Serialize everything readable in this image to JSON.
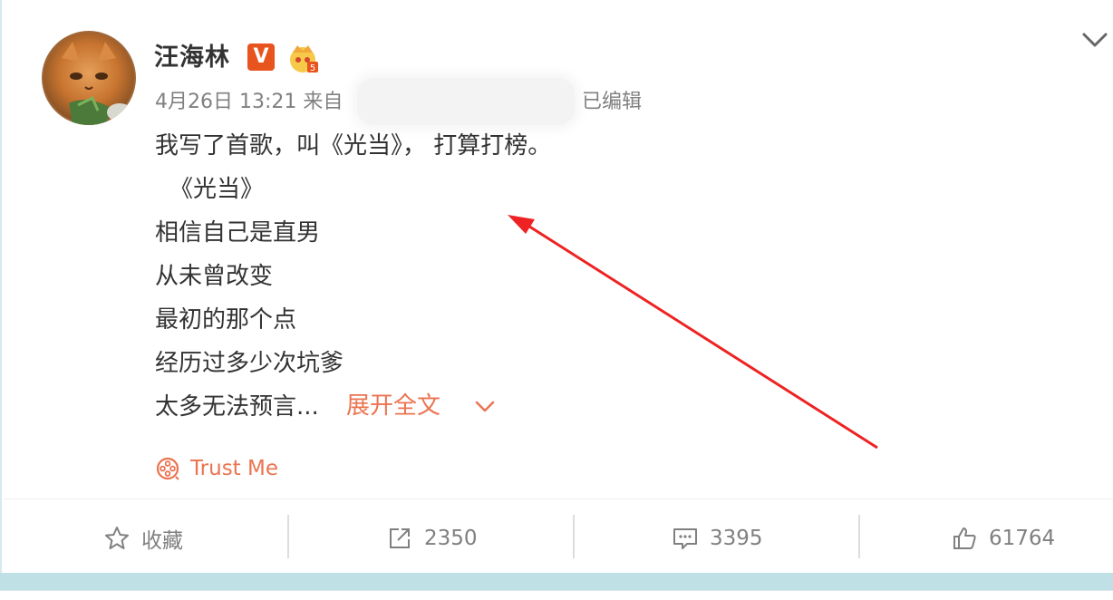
{
  "post": {
    "author": "汪海林",
    "verified_badge": "V",
    "vip_icon": "crown-icon",
    "meta_prefix": "4月26日 13:21 来自",
    "edited_label": "已编辑",
    "lines": [
      "我写了首歌，叫《光当》， 打算打榜。",
      "《光当》",
      "相信自己是直男",
      "从未曾改变",
      "最初的那个点",
      "经历过多少次坑爹",
      "太多无法预言..."
    ],
    "expand_label": "展开全文",
    "music_label": "Trust Me"
  },
  "actions": {
    "favorite": "收藏",
    "repost": "2350",
    "comment": "3395",
    "like": "61764"
  },
  "colors": {
    "link": "#eb7350",
    "text": "#333333",
    "muted": "#808080",
    "annotation_arrow": "#ee2222",
    "background": "#bfe1e6"
  }
}
